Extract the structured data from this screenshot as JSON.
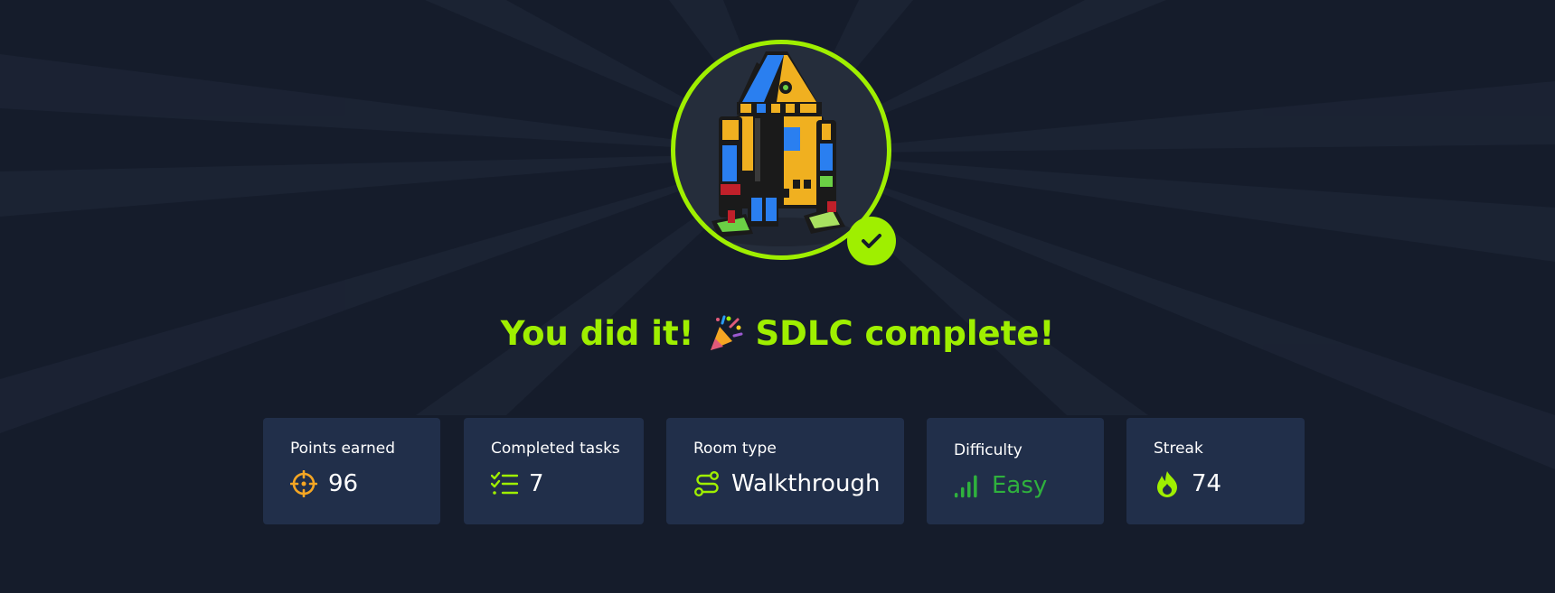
{
  "headline": {
    "text_before": "You did it!",
    "emoji_icon": "party-popper-icon",
    "text_after": "SDLC complete!",
    "color": "#9fef00"
  },
  "avatar": {
    "icon": "robot-avatar",
    "ring_color": "#9fef00",
    "badge_icon": "checkmark-icon"
  },
  "stats": [
    {
      "label": "Points earned",
      "value": "96",
      "icon": "crosshair-icon",
      "icon_color": "#f5a623"
    },
    {
      "label": "Completed tasks",
      "value": "7",
      "icon": "checklist-icon",
      "icon_color": "#9fef00"
    },
    {
      "label": "Room type",
      "value": "Walkthrough",
      "icon": "route-icon",
      "icon_color": "#9fef00"
    },
    {
      "label": "Difficulty",
      "value": "Easy",
      "icon": "signal-bars-icon",
      "icon_color": "#2fb13d"
    },
    {
      "label": "Streak",
      "value": "74",
      "icon": "flame-icon",
      "icon_color": "#9fef00"
    }
  ],
  "colors": {
    "background": "#151c2b",
    "card": "#212f4a",
    "accent": "#9fef00",
    "easy": "#2fb13d"
  }
}
